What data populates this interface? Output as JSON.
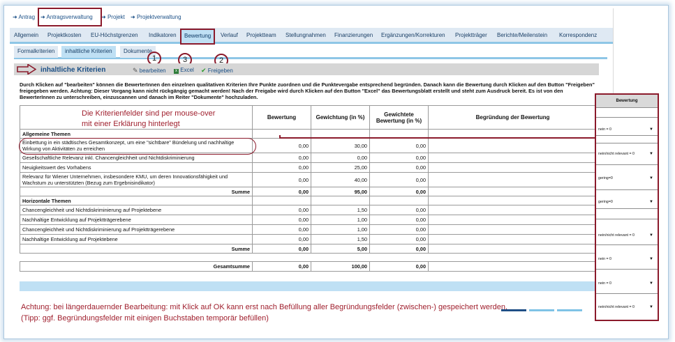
{
  "breadcrumb": {
    "items": [
      "Antrag",
      "Antragsverwaltung",
      "Projekt",
      "Projektverwaltung"
    ]
  },
  "nav": {
    "tabs": [
      "Allgemein",
      "Projektkosten",
      "EU-Höchstgrenzen",
      "Indikatoren",
      "Bewertung",
      "Verlauf",
      "Projektteam",
      "Stellungnahmen",
      "Finanzierungen",
      "Ergänzungen/Korrekturen",
      "Projektträger",
      "Berichte/Meilenstein",
      "Korrespondenz"
    ],
    "active": "Bewertung"
  },
  "subtabs": {
    "tabs": [
      "Formalkriterien",
      "inhaltliche Kriterien",
      "Dokumente"
    ],
    "active": "inhaltliche Kriterien"
  },
  "section": {
    "title": "inhaltliche Kriterien",
    "actions": {
      "edit": "bearbeiten",
      "excel": "Excel",
      "release": "Freigeben"
    },
    "markers": [
      "1",
      "3",
      "2"
    ]
  },
  "description": "Durch Klicken auf \"bearbeiten\" können die BewerterInnen den einzelnen qualitativen Kriterien Ihre Punkte zuordnen und die Punktevergabe entsprechend begründen. Danach kann die Bewertung durch Klicken auf den Button \"Freigeben\" freigegeben werden. Achtung: Dieser Vorgang kann nicht rückgängig gemacht werden! Nach der Freigabe wird durch Klicken auf den Button \"Excel\" das Bewertungsblatt erstellt und steht zum Ausdruck bereit. Es ist von den BewerterInnen zu unterschreiben, einzuscannen und danach im Reiter \"Dokumente\" hochzuladen.",
  "annotation_hover": [
    "Die Kriterienfelder sind per mouse-over",
    "mit einer Erklärung hinterlegt"
  ],
  "table": {
    "headers": {
      "bewertung": "Bewertung",
      "gewichtung": "Gewichtung (in %)",
      "gewichtet": "Gewichtete Bewertung (in %)",
      "begruendung": "Begründung der Bewertung"
    },
    "sections": [
      {
        "title": "Allgemeine Themen",
        "rows": [
          {
            "label": "Einbettung in ein städtisches Gesamtkonzept, um eine \"sichtbare\" Bündelung und nachhaltige Wirkung von Aktivitäten zu erreichen",
            "bewertung": "0,00",
            "gewichtung": "30,00",
            "gewichtet": "0,00"
          },
          {
            "label": "Gesellschaftliche Relevanz inkl. Chancengleichheit und Nichtdiskriminierung",
            "bewertung": "0,00",
            "gewichtung": "0,00",
            "gewichtet": "0,00"
          },
          {
            "label": "Neuigkeitswert des Vorhabens",
            "bewertung": "0,00",
            "gewichtung": "25,00",
            "gewichtet": "0,00"
          },
          {
            "label": "Relevanz für Wiener Unternehmen, insbesondere KMU, um deren Innovationsfähigkeit und Wachstum zu unterstützten (Bezug zum Ergebnisindikator)",
            "bewertung": "0,00",
            "gewichtung": "40,00",
            "gewichtet": "0,00"
          }
        ],
        "sum_label": "Summe",
        "sum": {
          "bewertung": "0,00",
          "gewichtung": "95,00",
          "gewichtet": "0,00"
        }
      },
      {
        "title": "Horizontale Themen",
        "rows": [
          {
            "label": "Chancengleichheit und Nichtdiskriminierung auf Projektebene",
            "bewertung": "0,00",
            "gewichtung": "1,50",
            "gewichtet": "0,00"
          },
          {
            "label": "Nachhaltige Entwicklung auf Projektträgerebene",
            "bewertung": "0,00",
            "gewichtung": "1,00",
            "gewichtet": "0,00"
          },
          {
            "label": "Chancengleichheit und Nichtdiskriminierung auf Projektträgerebene",
            "bewertung": "0,00",
            "gewichtung": "1,00",
            "gewichtet": "0,00"
          },
          {
            "label": "Nachhaltige Entwicklung auf Projektebene",
            "bewertung": "0,00",
            "gewichtung": "1,50",
            "gewichtet": "0,00"
          }
        ],
        "sum_label": "Summe",
        "sum": {
          "bewertung": "0,00",
          "gewichtung": "5,00",
          "gewichtet": "0,00"
        }
      }
    ],
    "total": {
      "label": "Gesamtsumme",
      "bewertung": "0,00",
      "gewichtung": "100,00",
      "gewichtet": "0,00"
    }
  },
  "right_panel": {
    "header": "Bewertung",
    "selects": [
      "nein = 0",
      "nein/nicht relevant = 0",
      "gering=0",
      "gering=0",
      "nein/nicht relevant = 0",
      "nein = 0",
      "nein = 0",
      "nein/nicht relevant = 0"
    ]
  },
  "bottom_note": "Achtung: bei längerdauernder Bearbeitung: mit Klick auf OK kann erst nach Befüllung aller Begründungsfelder (zwischen-) gespeichert werden. (Tipp: ggf. Begründungsfelder mit einigen Buchstaben temporär befüllen)",
  "colors": {
    "annotation": "#8b1a2b",
    "link": "#1a4f86",
    "tab_bg": "#dfe9f3",
    "tab_active": "#bfe0f4"
  }
}
